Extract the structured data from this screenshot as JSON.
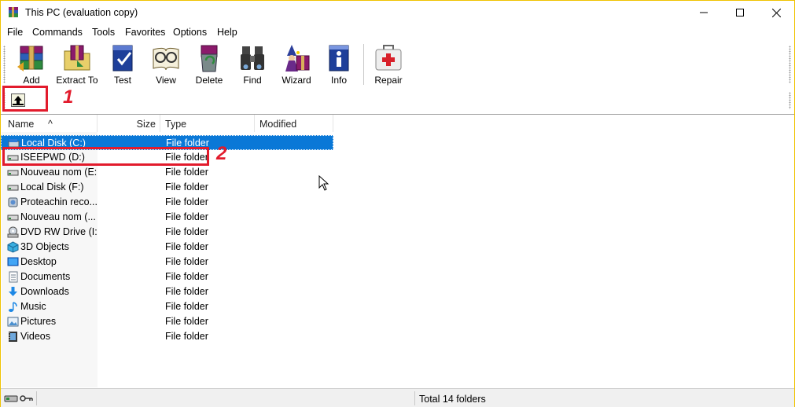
{
  "window": {
    "title": "This PC (evaluation copy)"
  },
  "menu": [
    "File",
    "Commands",
    "Tools",
    "Favorites",
    "Options",
    "Help"
  ],
  "toolbar": [
    {
      "label": "Add",
      "icon": "add-archive-icon"
    },
    {
      "label": "Extract To",
      "icon": "extract-to-icon"
    },
    {
      "label": "Test",
      "icon": "test-icon"
    },
    {
      "label": "View",
      "icon": "view-icon"
    },
    {
      "label": "Delete",
      "icon": "delete-icon"
    },
    {
      "label": "Find",
      "icon": "find-binoculars-icon"
    },
    {
      "label": "Wizard",
      "icon": "wizard-icon"
    },
    {
      "label": "Info",
      "icon": "info-icon"
    },
    {
      "label": "Repair",
      "icon": "repair-first-aid-icon"
    }
  ],
  "annotations": {
    "first": "1",
    "second": "2"
  },
  "columns": {
    "name": "Name",
    "size": "Size",
    "type": "Type",
    "modified": "Modified"
  },
  "rows": [
    {
      "name": "Local Disk (C:)",
      "type": "File folder",
      "icon": "system-drive-icon",
      "selected": true
    },
    {
      "name": "ISEEPWD (D:)",
      "type": "File folder",
      "icon": "drive-icon"
    },
    {
      "name": "Nouveau nom (E:)",
      "type": "File folder",
      "icon": "drive-icon"
    },
    {
      "name": "Local Disk (F:)",
      "type": "File folder",
      "icon": "drive-icon"
    },
    {
      "name": "Proteachin reco...",
      "type": "File folder",
      "icon": "recovery-drive-icon"
    },
    {
      "name": "Nouveau nom (...",
      "type": "File folder",
      "icon": "drive-icon"
    },
    {
      "name": "DVD RW Drive (I:)",
      "type": "File folder",
      "icon": "dvd-drive-icon"
    },
    {
      "name": "3D Objects",
      "type": "File folder",
      "icon": "3d-objects-icon"
    },
    {
      "name": "Desktop",
      "type": "File folder",
      "icon": "desktop-icon"
    },
    {
      "name": "Documents",
      "type": "File folder",
      "icon": "documents-icon"
    },
    {
      "name": "Downloads",
      "type": "File folder",
      "icon": "downloads-icon"
    },
    {
      "name": "Music",
      "type": "File folder",
      "icon": "music-icon"
    },
    {
      "name": "Pictures",
      "type": "File folder",
      "icon": "pictures-icon"
    },
    {
      "name": "Videos",
      "type": "File folder",
      "icon": "videos-icon"
    }
  ],
  "status": {
    "text": "Total 14 folders"
  },
  "colors": {
    "selection": "#0a78d7",
    "annotation": "#e21b2c",
    "window_border": "#f0c300"
  }
}
